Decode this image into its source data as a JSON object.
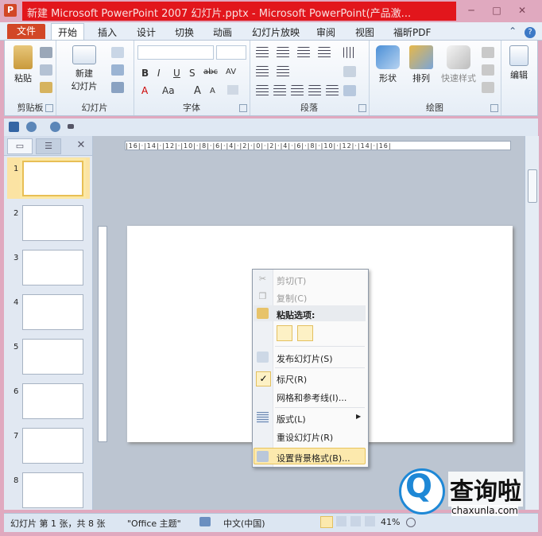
{
  "window": {
    "title": "新建 Microsoft PowerPoint 2007 幻灯片.pptx - Microsoft PowerPoint(产品激...",
    "app_icon_letter": "P",
    "controls": [
      "─",
      "□",
      "✕"
    ]
  },
  "ribbon_tabs": {
    "file": "文件",
    "tabs": [
      "开始",
      "插入",
      "设计",
      "切换",
      "动画",
      "幻灯片放映",
      "审阅",
      "视图",
      "福昕PDF"
    ]
  },
  "ribbon": {
    "clipboard": {
      "label": "剪贴板",
      "paste": "粘贴"
    },
    "slides": {
      "label": "幻灯片",
      "new_slide_line1": "新建",
      "new_slide_line2": "幻灯片"
    },
    "font": {
      "label": "字体",
      "bold": "B",
      "italic": "I",
      "underline": "U",
      "strike": "S",
      "shadow": "abc",
      "spacing": "AV",
      "color": "A",
      "case": "Aa",
      "grow": "A",
      "shrink": "A"
    },
    "paragraph": {
      "label": "段落"
    },
    "drawing": {
      "label": "绘图",
      "shapes": "形状",
      "arrange": "排列",
      "quick_styles": "快速样式"
    },
    "editing": {
      "label": "编辑"
    }
  },
  "slides_pane": {
    "tab1": "▭",
    "tab2": "☰",
    "close": "✕",
    "numbers": [
      "1",
      "2",
      "3",
      "4",
      "5",
      "6",
      "7",
      "8"
    ]
  },
  "ruler": {
    "horizontal": "|16|·|14|·|12|·|10|·|8|·|6|·|4|·|2|·|0|·|2|·|4|·|6|·|8|·|10|·|12|·|14|·|16|"
  },
  "context_menu": {
    "cut": "剪切(T)",
    "copy": "复制(C)",
    "paste_options": "粘贴选项:",
    "publish": "发布幻灯片(S)",
    "ruler": "标尺(R)",
    "grid": "网格和参考线(I)...",
    "layout": "版式(L)",
    "reset": "重设幻灯片(R)",
    "format_bg": "设置背景格式(B)..."
  },
  "status": {
    "slide_info": "幻灯片 第 1 张，共 8 张",
    "theme": "\"Office 主题\"",
    "language": "中文(中国)",
    "zoom": "41%"
  },
  "watermark": {
    "brand": "查询啦",
    "url": "chaxunla.com"
  },
  "colors": {
    "title_highlight": "#e2161c",
    "file_tab": "#d24726",
    "accent": "#1e88d6"
  }
}
